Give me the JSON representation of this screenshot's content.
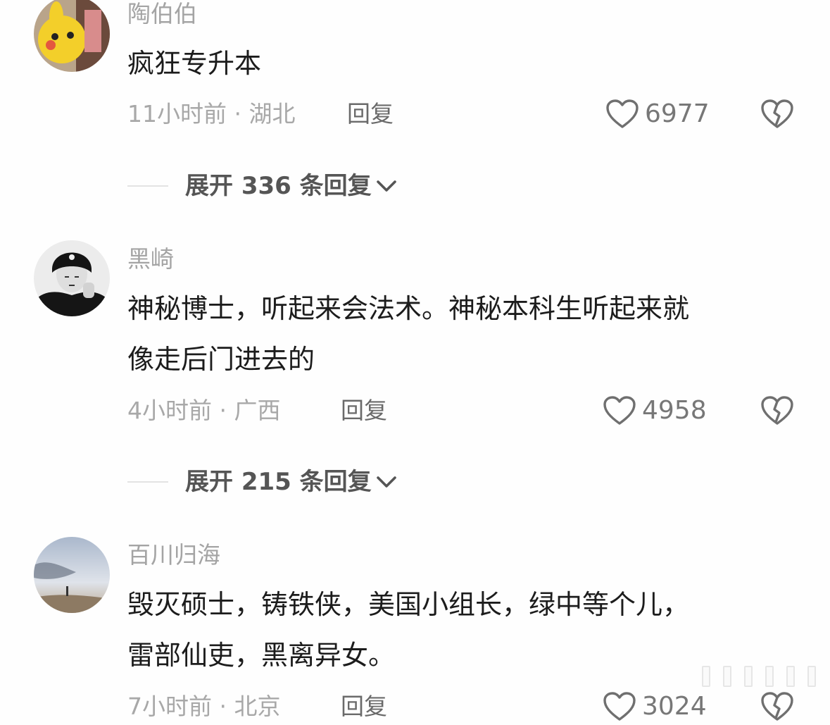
{
  "comments": [
    {
      "username": "陶伯伯",
      "text_lines": [
        "疯狂专升本"
      ],
      "time_location": "11小时前 · 湖北",
      "reply_label": "回复",
      "likes": "6977",
      "expand_label": "展开 336 条回复"
    },
    {
      "username": "黑崎",
      "text_lines": [
        "神秘博士，听起来会法术。神秘本科生听起来就",
        "像走后门进去的"
      ],
      "time_location": "4小时前 · 广西",
      "reply_label": "回复",
      "likes": "4958",
      "expand_label": "展开 215 条回复"
    },
    {
      "username": "百川归海",
      "text_lines": [
        "毁灭硕士，铸铁侠，美国小组长，绿中等个儿，",
        "雷部仙吏，黑离异女。"
      ],
      "time_location": "7小时前 · 北京",
      "reply_label": "回复",
      "likes": "3024"
    }
  ],
  "icons": {
    "like": "heart-outline-icon",
    "dislike": "broken-heart-icon",
    "expand": "chevron-down-icon"
  },
  "colors": {
    "muted": "#a4a4a4",
    "text": "#1c1c1c",
    "action": "#6a6a6a"
  }
}
